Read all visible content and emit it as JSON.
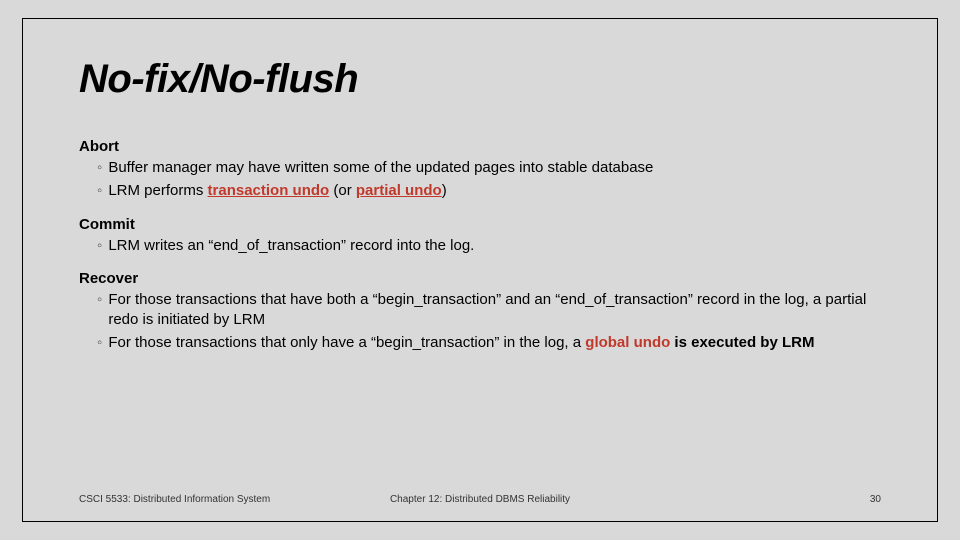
{
  "title": "No-fix/No-flush",
  "sections": {
    "abort": {
      "head": "Abort",
      "b1": "Buffer manager may have written some of the updated pages into stable database",
      "b2_pre": "LRM  performs ",
      "b2_em1": "transaction undo",
      "b2_mid": " (or ",
      "b2_em2": "partial undo",
      "b2_post": ")"
    },
    "commit": {
      "head": "Commit",
      "b1": "LRM writes an “end_of_transaction” record into the log."
    },
    "recover": {
      "head": "Recover",
      "b1": "For those transactions that have both a “begin_transaction” and an “end_of_transaction” record in the log, a partial redo is initiated by LRM",
      "b2_pre": "For those transactions that only have a “begin_transaction” in the log, a ",
      "b2_em": "global undo",
      "b2_post": " is executed by LRM"
    }
  },
  "footer": {
    "left": "CSCI 5533: Distributed Information System",
    "center": "Chapter 12: Distributed DBMS Reliability",
    "right": "30"
  },
  "bullet": "◦"
}
